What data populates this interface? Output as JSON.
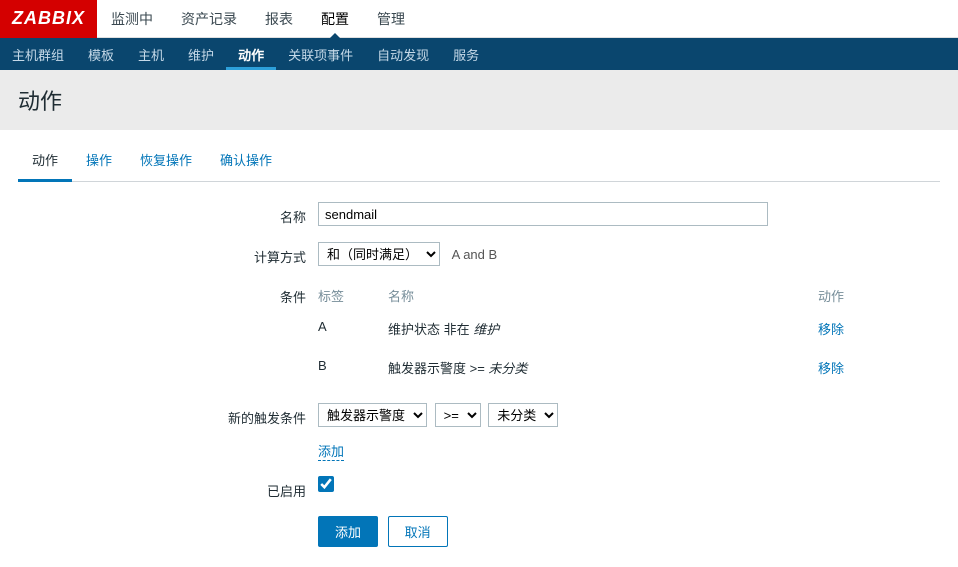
{
  "logo": "ZABBIX",
  "mainmenu": [
    {
      "label": "监测中",
      "active": false
    },
    {
      "label": "资产记录",
      "active": false
    },
    {
      "label": "报表",
      "active": false
    },
    {
      "label": "配置",
      "active": true
    },
    {
      "label": "管理",
      "active": false
    }
  ],
  "submenu": [
    {
      "label": "主机群组",
      "active": false
    },
    {
      "label": "模板",
      "active": false
    },
    {
      "label": "主机",
      "active": false
    },
    {
      "label": "维护",
      "active": false
    },
    {
      "label": "动作",
      "active": true
    },
    {
      "label": "关联项事件",
      "active": false
    },
    {
      "label": "自动发现",
      "active": false
    },
    {
      "label": "服务",
      "active": false
    }
  ],
  "page_title": "动作",
  "tabs": [
    {
      "label": "动作",
      "active": true
    },
    {
      "label": "操作",
      "active": false
    },
    {
      "label": "恢复操作",
      "active": false
    },
    {
      "label": "确认操作",
      "active": false
    }
  ],
  "form": {
    "name_label": "名称",
    "name_value": "sendmail",
    "calc_label": "计算方式",
    "calc_selected": "和（同时满足）",
    "calc_hint": "A and B",
    "cond_label": "条件",
    "cond_header_tag": "标签",
    "cond_header_name": "名称",
    "cond_header_action": "动作",
    "conditions": [
      {
        "tag": "A",
        "name_prefix": "维护状态 非在 ",
        "name_italic": "维护",
        "action": "移除"
      },
      {
        "tag": "B",
        "name_prefix": "触发器示警度 >= ",
        "name_italic": "未分类",
        "action": "移除"
      }
    ],
    "newcond_label": "新的触发条件",
    "newcond_sel1": "触发器示警度",
    "newcond_sel2": ">=",
    "newcond_sel3": "未分类",
    "newcond_add": "添加",
    "enabled_label": "已启用",
    "enabled_checked": true,
    "btn_add": "添加",
    "btn_cancel": "取消"
  }
}
